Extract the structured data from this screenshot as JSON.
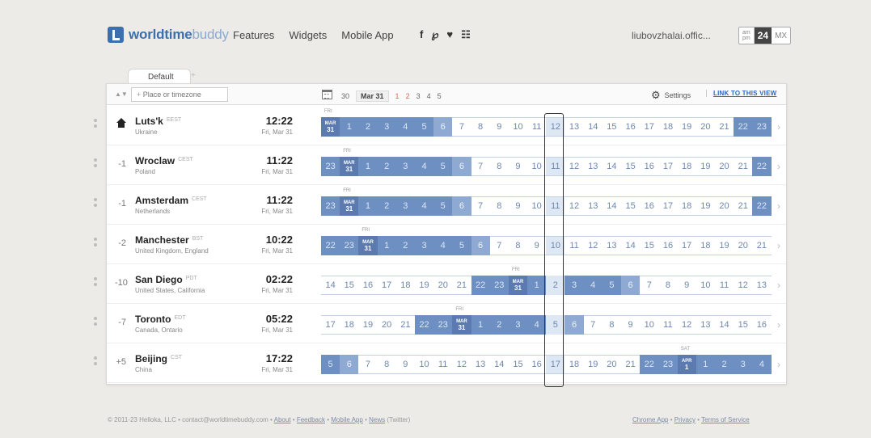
{
  "header": {
    "logo_bold": "worldtime",
    "logo_light": "buddy",
    "nav": [
      "Features",
      "Widgets",
      "Mobile App"
    ],
    "social": [
      "f",
      "℘",
      "♥",
      "☷"
    ],
    "user": "liubovzhalai.offic...",
    "format": {
      "ampm_top": "am",
      "ampm_bottom": "pm",
      "h24": "24",
      "mx": "MX"
    }
  },
  "tab": {
    "label": "Default",
    "add": "+"
  },
  "toolbar": {
    "sort_icon": "▲▼",
    "search_placeholder": "Place or timezone",
    "search_plus": "+",
    "date_items": [
      {
        "t": "30",
        "cls": "gray"
      },
      {
        "t": "Mar 31",
        "cls": "cur"
      },
      {
        "t": "1",
        "cls": "red"
      },
      {
        "t": "2",
        "cls": "red"
      },
      {
        "t": "3",
        "cls": "gray"
      },
      {
        "t": "4",
        "cls": "gray"
      },
      {
        "t": "5",
        "cls": "gray"
      }
    ],
    "settings": "Settings",
    "link_view": "LINK TO THIS VIEW"
  },
  "rows": [
    {
      "offset": "",
      "home": true,
      "city": "Luts'k",
      "abbr": "EEST",
      "country": "Ukraine",
      "time": "12:22",
      "date": "Fri, Mar 31",
      "flag": "FRI",
      "flag_idx": 0,
      "cells": [
        {
          "t": "MAR|31",
          "k": "m"
        },
        {
          "t": "1",
          "k": "n"
        },
        {
          "t": "2",
          "k": "n"
        },
        {
          "t": "3",
          "k": "n"
        },
        {
          "t": "4",
          "k": "n"
        },
        {
          "t": "5",
          "k": "n"
        },
        {
          "t": "6",
          "k": "d"
        },
        {
          "t": "7",
          "k": "l"
        },
        {
          "t": "8",
          "k": "l"
        },
        {
          "t": "9",
          "k": "l"
        },
        {
          "t": "10",
          "k": "l"
        },
        {
          "t": "11",
          "k": "l"
        },
        {
          "t": "12",
          "k": "l"
        },
        {
          "t": "13",
          "k": "l"
        },
        {
          "t": "14",
          "k": "l"
        },
        {
          "t": "15",
          "k": "l"
        },
        {
          "t": "16",
          "k": "l"
        },
        {
          "t": "17",
          "k": "l"
        },
        {
          "t": "18",
          "k": "l"
        },
        {
          "t": "19",
          "k": "l"
        },
        {
          "t": "20",
          "k": "l"
        },
        {
          "t": "21",
          "k": "l"
        },
        {
          "t": "22",
          "k": "n"
        },
        {
          "t": "23",
          "k": "n"
        }
      ]
    },
    {
      "offset": "-1",
      "home": false,
      "city": "Wroclaw",
      "abbr": "CEST",
      "country": "Poland",
      "time": "11:22",
      "date": "Fri, Mar 31",
      "flag": "FRI",
      "flag_idx": 1,
      "cells": [
        {
          "t": "23",
          "k": "n"
        },
        {
          "t": "MAR|31",
          "k": "m"
        },
        {
          "t": "1",
          "k": "n"
        },
        {
          "t": "2",
          "k": "n"
        },
        {
          "t": "3",
          "k": "n"
        },
        {
          "t": "4",
          "k": "n"
        },
        {
          "t": "5",
          "k": "n"
        },
        {
          "t": "6",
          "k": "d"
        },
        {
          "t": "7",
          "k": "l"
        },
        {
          "t": "8",
          "k": "l"
        },
        {
          "t": "9",
          "k": "l"
        },
        {
          "t": "10",
          "k": "l"
        },
        {
          "t": "11",
          "k": "l"
        },
        {
          "t": "12",
          "k": "l"
        },
        {
          "t": "13",
          "k": "l"
        },
        {
          "t": "14",
          "k": "l"
        },
        {
          "t": "15",
          "k": "l"
        },
        {
          "t": "16",
          "k": "l"
        },
        {
          "t": "17",
          "k": "l"
        },
        {
          "t": "18",
          "k": "l"
        },
        {
          "t": "19",
          "k": "l"
        },
        {
          "t": "20",
          "k": "l"
        },
        {
          "t": "21",
          "k": "l"
        },
        {
          "t": "22",
          "k": "n"
        }
      ]
    },
    {
      "offset": "-1",
      "home": false,
      "city": "Amsterdam",
      "abbr": "CEST",
      "country": "Netherlands",
      "time": "11:22",
      "date": "Fri, Mar 31",
      "flag": "FRI",
      "flag_idx": 1,
      "cells": [
        {
          "t": "23",
          "k": "n"
        },
        {
          "t": "MAR|31",
          "k": "m"
        },
        {
          "t": "1",
          "k": "n"
        },
        {
          "t": "2",
          "k": "n"
        },
        {
          "t": "3",
          "k": "n"
        },
        {
          "t": "4",
          "k": "n"
        },
        {
          "t": "5",
          "k": "n"
        },
        {
          "t": "6",
          "k": "d"
        },
        {
          "t": "7",
          "k": "l"
        },
        {
          "t": "8",
          "k": "l"
        },
        {
          "t": "9",
          "k": "l"
        },
        {
          "t": "10",
          "k": "l"
        },
        {
          "t": "11",
          "k": "l"
        },
        {
          "t": "12",
          "k": "l"
        },
        {
          "t": "13",
          "k": "l"
        },
        {
          "t": "14",
          "k": "l"
        },
        {
          "t": "15",
          "k": "l"
        },
        {
          "t": "16",
          "k": "l"
        },
        {
          "t": "17",
          "k": "l"
        },
        {
          "t": "18",
          "k": "l"
        },
        {
          "t": "19",
          "k": "l"
        },
        {
          "t": "20",
          "k": "l"
        },
        {
          "t": "21",
          "k": "l"
        },
        {
          "t": "22",
          "k": "n"
        }
      ]
    },
    {
      "offset": "-2",
      "home": false,
      "city": "Manchester",
      "abbr": "BST",
      "country": "United Kingdom, England",
      "time": "10:22",
      "date": "Fri, Mar 31",
      "flag": "FRI",
      "flag_idx": 2,
      "cells": [
        {
          "t": "22",
          "k": "n"
        },
        {
          "t": "23",
          "k": "n"
        },
        {
          "t": "MAR|31",
          "k": "m"
        },
        {
          "t": "1",
          "k": "n"
        },
        {
          "t": "2",
          "k": "n"
        },
        {
          "t": "3",
          "k": "n"
        },
        {
          "t": "4",
          "k": "n"
        },
        {
          "t": "5",
          "k": "n"
        },
        {
          "t": "6",
          "k": "d"
        },
        {
          "t": "7",
          "k": "l"
        },
        {
          "t": "8",
          "k": "l"
        },
        {
          "t": "9",
          "k": "l"
        },
        {
          "t": "10",
          "k": "l"
        },
        {
          "t": "11",
          "k": "l"
        },
        {
          "t": "12",
          "k": "l"
        },
        {
          "t": "13",
          "k": "l"
        },
        {
          "t": "14",
          "k": "l"
        },
        {
          "t": "15",
          "k": "l"
        },
        {
          "t": "16",
          "k": "l"
        },
        {
          "t": "17",
          "k": "l"
        },
        {
          "t": "18",
          "k": "l"
        },
        {
          "t": "19",
          "k": "l"
        },
        {
          "t": "20",
          "k": "l"
        },
        {
          "t": "21",
          "k": "l"
        }
      ]
    },
    {
      "offset": "-10",
      "home": false,
      "city": "San Diego",
      "abbr": "PDT",
      "country": "United States, California",
      "time": "02:22",
      "date": "Fri, Mar 31",
      "flag": "FRI",
      "flag_idx": 10,
      "cells": [
        {
          "t": "14",
          "k": "l"
        },
        {
          "t": "15",
          "k": "l"
        },
        {
          "t": "16",
          "k": "l"
        },
        {
          "t": "17",
          "k": "l"
        },
        {
          "t": "18",
          "k": "l"
        },
        {
          "t": "19",
          "k": "l"
        },
        {
          "t": "20",
          "k": "l"
        },
        {
          "t": "21",
          "k": "l"
        },
        {
          "t": "22",
          "k": "n"
        },
        {
          "t": "23",
          "k": "n"
        },
        {
          "t": "MAR|31",
          "k": "m"
        },
        {
          "t": "1",
          "k": "n"
        },
        {
          "t": "2",
          "k": "n"
        },
        {
          "t": "3",
          "k": "n"
        },
        {
          "t": "4",
          "k": "n"
        },
        {
          "t": "5",
          "k": "n"
        },
        {
          "t": "6",
          "k": "d"
        },
        {
          "t": "7",
          "k": "l"
        },
        {
          "t": "8",
          "k": "l"
        },
        {
          "t": "9",
          "k": "l"
        },
        {
          "t": "10",
          "k": "l"
        },
        {
          "t": "11",
          "k": "l"
        },
        {
          "t": "12",
          "k": "l"
        },
        {
          "t": "13",
          "k": "l"
        }
      ]
    },
    {
      "offset": "-7",
      "home": false,
      "city": "Toronto",
      "abbr": "EDT",
      "country": "Canada, Ontario",
      "time": "05:22",
      "date": "Fri, Mar 31",
      "flag": "FRI",
      "flag_idx": 7,
      "cells": [
        {
          "t": "17",
          "k": "l"
        },
        {
          "t": "18",
          "k": "l"
        },
        {
          "t": "19",
          "k": "l"
        },
        {
          "t": "20",
          "k": "l"
        },
        {
          "t": "21",
          "k": "l"
        },
        {
          "t": "22",
          "k": "n"
        },
        {
          "t": "23",
          "k": "n"
        },
        {
          "t": "MAR|31",
          "k": "m"
        },
        {
          "t": "1",
          "k": "n"
        },
        {
          "t": "2",
          "k": "n"
        },
        {
          "t": "3",
          "k": "n"
        },
        {
          "t": "4",
          "k": "n"
        },
        {
          "t": "5",
          "k": "n"
        },
        {
          "t": "6",
          "k": "d"
        },
        {
          "t": "7",
          "k": "l"
        },
        {
          "t": "8",
          "k": "l"
        },
        {
          "t": "9",
          "k": "l"
        },
        {
          "t": "10",
          "k": "l"
        },
        {
          "t": "11",
          "k": "l"
        },
        {
          "t": "12",
          "k": "l"
        },
        {
          "t": "13",
          "k": "l"
        },
        {
          "t": "14",
          "k": "l"
        },
        {
          "t": "15",
          "k": "l"
        },
        {
          "t": "16",
          "k": "l"
        }
      ]
    },
    {
      "offset": "+5",
      "home": false,
      "city": "Beijing",
      "abbr": "CST",
      "country": "China",
      "time": "17:22",
      "date": "Fri, Mar 31",
      "flag": "SAT",
      "flag_idx": 19,
      "cells": [
        {
          "t": "5",
          "k": "n"
        },
        {
          "t": "6",
          "k": "d"
        },
        {
          "t": "7",
          "k": "l"
        },
        {
          "t": "8",
          "k": "l"
        },
        {
          "t": "9",
          "k": "l"
        },
        {
          "t": "10",
          "k": "l"
        },
        {
          "t": "11",
          "k": "l"
        },
        {
          "t": "12",
          "k": "l"
        },
        {
          "t": "13",
          "k": "l"
        },
        {
          "t": "14",
          "k": "l"
        },
        {
          "t": "15",
          "k": "l"
        },
        {
          "t": "16",
          "k": "l"
        },
        {
          "t": "17",
          "k": "l"
        },
        {
          "t": "18",
          "k": "l"
        },
        {
          "t": "19",
          "k": "l"
        },
        {
          "t": "20",
          "k": "l"
        },
        {
          "t": "21",
          "k": "l"
        },
        {
          "t": "22",
          "k": "n"
        },
        {
          "t": "23",
          "k": "n"
        },
        {
          "t": "APR|1",
          "k": "m"
        },
        {
          "t": "1",
          "k": "n"
        },
        {
          "t": "2",
          "k": "n"
        },
        {
          "t": "3",
          "k": "n"
        },
        {
          "t": "4",
          "k": "n"
        }
      ]
    }
  ],
  "selected_col": 12,
  "footer": {
    "copyright": "© 2011-23 Helloka, LLC  •  contact@worldtimebuddy.com  •",
    "about": "About",
    "feedback": "Feedback",
    "mobile_app": "Mobile App",
    "news": "News",
    "twitter": "(Twitter)",
    "chrome_app": "Chrome App",
    "privacy": "Privacy",
    "terms": "Terms of Service",
    "sep": "•"
  },
  "colors": {
    "night": "#6e8fc2",
    "dawn": "#8faad2",
    "day": "#ffffff",
    "accent": "#3b6fae",
    "link": "#2c66c6"
  }
}
